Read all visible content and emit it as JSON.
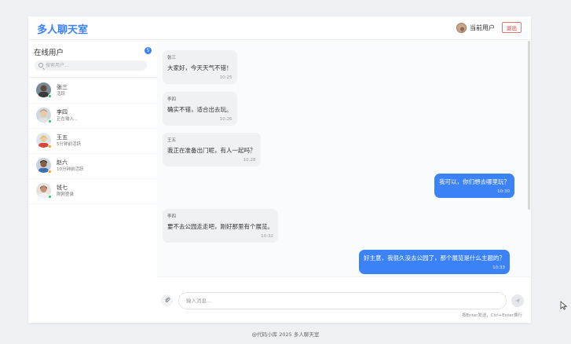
{
  "header": {
    "title": "多人聊天室",
    "current_user_label": "当前用户",
    "logout_label": "退出"
  },
  "sidebar": {
    "title": "在线用户",
    "online_count": "5",
    "search_placeholder": "搜索用户...",
    "users": [
      {
        "name": "张三",
        "status": "活跃",
        "status_color": "#22c55e",
        "avatar_bg": "#5b4a3f"
      },
      {
        "name": "李四",
        "status": "正在输入...",
        "status_color": "#22c55e",
        "avatar_bg": "#e7b98a"
      },
      {
        "name": "王五",
        "status": "5分钟前活跃",
        "status_color": "#f59e0b",
        "avatar_bg": "#f2c9a0"
      },
      {
        "name": "赵六",
        "status": "10分钟前活跃",
        "status_color": "#f59e0b",
        "avatar_bg": "#8b5e3c"
      },
      {
        "name": "钱七",
        "status": "刚刚登录",
        "status_color": "#22c55e",
        "avatar_bg": "#c89070"
      }
    ]
  },
  "messages": [
    {
      "sender": "张三",
      "text": "大家好，今天天气不错！",
      "time": "10:25",
      "direction": "in"
    },
    {
      "sender": "李四",
      "text": "确实不错，适合出去玩。",
      "time": "10:26",
      "direction": "in"
    },
    {
      "sender": "王五",
      "text": "我正在准备出门呢，有人一起吗？",
      "time": "10:28",
      "direction": "in"
    },
    {
      "sender": "",
      "text": "我可以，你们想去哪里玩？",
      "time": "10:30",
      "direction": "out"
    },
    {
      "sender": "李四",
      "text": "要不去公园走走吧，刚好那里有个展览。",
      "time": "10:32",
      "direction": "in"
    },
    {
      "sender": "",
      "text": "好主意，我很久没去公园了，那个展览是什么主题的？",
      "time": "10:33",
      "direction": "out"
    }
  ],
  "composer": {
    "placeholder": "输入消息...",
    "hint": "按Enter发送，Ctrl+Enter换行",
    "attach_icon": "paperclip-icon",
    "send_icon": "send-icon"
  },
  "footer": {
    "text": "@代码小库 2025 多人聊天室"
  },
  "colors": {
    "accent": "#3b82f6",
    "logout": "#e53935",
    "online": "#22c55e",
    "away": "#f59e0b"
  }
}
